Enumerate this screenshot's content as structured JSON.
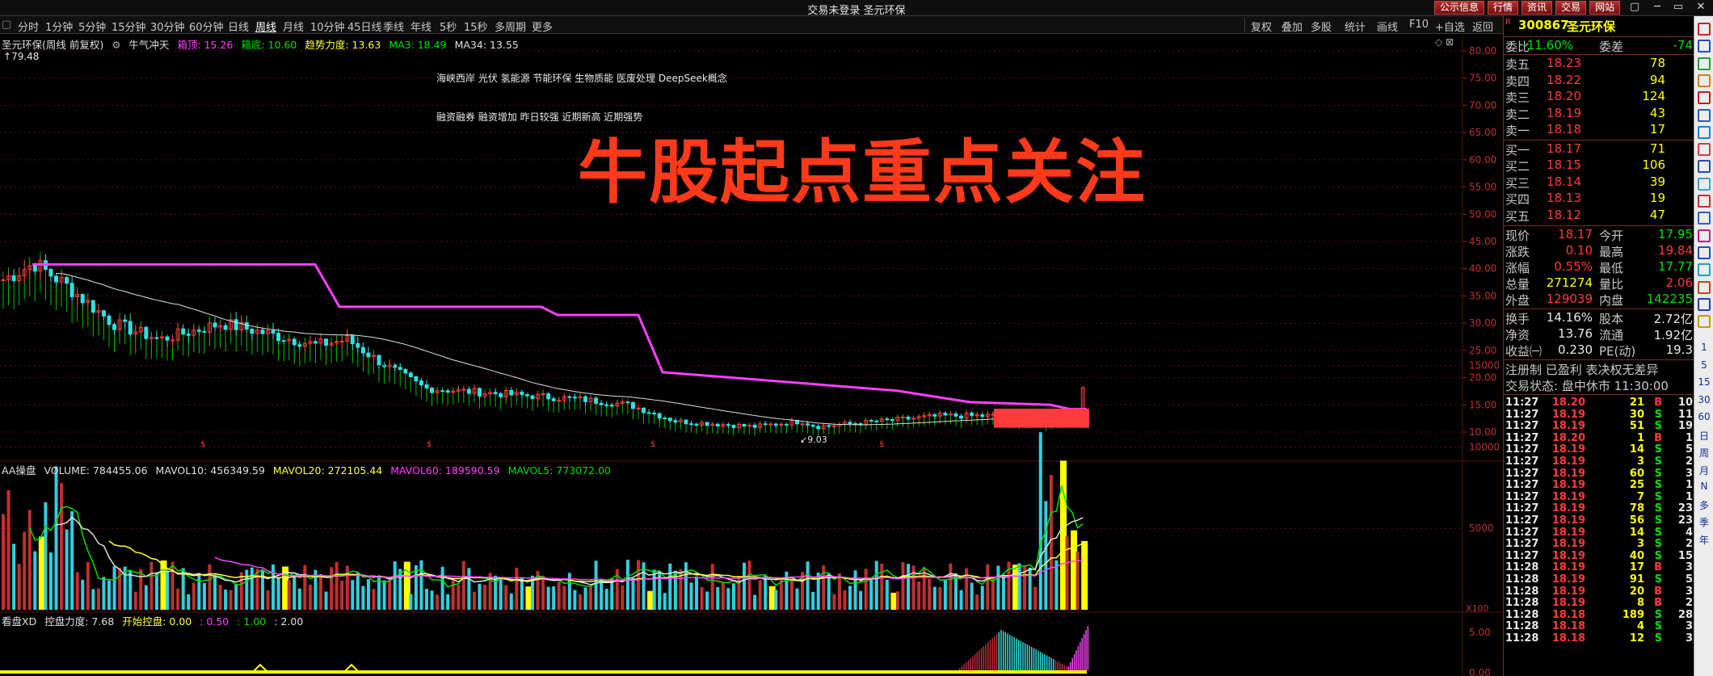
{
  "window": {
    "title": "交易未登录 圣元环保",
    "top_buttons": [
      "公示信息",
      "行情",
      "资讯",
      "交易",
      "网站"
    ],
    "controls": [
      "▢",
      "─",
      "▭",
      "✕"
    ]
  },
  "toolbar": {
    "periods": [
      "分时",
      "1分钟",
      "5分钟",
      "15分钟",
      "30分钟",
      "60分钟",
      "日线",
      "周线",
      "月线",
      "10分钟",
      "45日线",
      "季线",
      "年线",
      "5秒",
      "15秒",
      "多周期",
      "更多"
    ],
    "active_period": "周线",
    "tools": [
      "复权",
      "叠加",
      "多股",
      "统计",
      "画线",
      "F10",
      "+自选",
      "返回"
    ]
  },
  "chart_header": {
    "stock": "圣元环保(周线 前复权)",
    "indicator": "牛气冲天",
    "items": [
      {
        "label": "箱顶: 15.26",
        "color": "#ff40ff"
      },
      {
        "label": "箱底: 10.60",
        "color": "#00e000"
      },
      {
        "label": "趋势力度: 13.63",
        "color": "#ffff40"
      },
      {
        "label": "MA3: 18.49",
        "color": "#00e000"
      },
      {
        "label": "MA34: 13.55",
        "color": "#e0e0e0"
      }
    ],
    "high_mark": "79.48",
    "low_mark": "9.03"
  },
  "concepts": {
    "line1": "海峡西岸 光伏 氢能源 节能环保 生物质能 医废处理 DeepSeek概念",
    "line2": "融资融券 融资增加 昨日较强 近期新高 近期强势"
  },
  "overlay_text": "牛股起点重点关注",
  "price_axis": [
    "80.00",
    "75.00",
    "70.00",
    "65.00",
    "60.00",
    "55.00",
    "50.00",
    "45.00",
    "40.00",
    "35.00",
    "30.00",
    "25.00",
    "20.00",
    "15.00",
    "10.00"
  ],
  "volume_header": {
    "name": "AA操盘",
    "items": [
      {
        "label": "VOLUME: 784455.06",
        "color": "#e0e0e0"
      },
      {
        "label": "MAVOL10: 456349.59",
        "color": "#e0e0e0"
      },
      {
        "label": "MAVOL20: 272105.44",
        "color": "#ffff40"
      },
      {
        "label": "MAVOL60: 189590.59",
        "color": "#ff40ff"
      },
      {
        "label": "MAVOL5: 773072.00",
        "color": "#00e000"
      }
    ],
    "axis": [
      "15000",
      "10000",
      "5000"
    ],
    "unit": "X100"
  },
  "control_header": {
    "name": "看盘XD",
    "items": [
      {
        "label": "控盘力度: 7.68",
        "color": "#e0e0e0"
      },
      {
        "label": "开始控盘: 0.00",
        "color": "#ffff40"
      },
      {
        "label": ": 0.50",
        "color": "#ff40ff"
      },
      {
        "label": ": 1.00",
        "color": "#00e000"
      },
      {
        "label": ": 2.00",
        "color": "#e0e0e0"
      }
    ],
    "axis": [
      "5.00",
      "0.00"
    ]
  },
  "quote": {
    "code": "300867",
    "name": "圣元环保",
    "weibi_label": "委比",
    "weibi": "-11.60%",
    "weicha_label": "委差",
    "weicha": "-74",
    "asks": [
      {
        "label": "卖五",
        "price": "18.23",
        "vol": "78"
      },
      {
        "label": "卖四",
        "price": "18.22",
        "vol": "94"
      },
      {
        "label": "卖三",
        "price": "18.20",
        "vol": "124"
      },
      {
        "label": "卖二",
        "price": "18.19",
        "vol": "43"
      },
      {
        "label": "卖一",
        "price": "18.18",
        "vol": "17"
      }
    ],
    "bids": [
      {
        "label": "买一",
        "price": "18.17",
        "vol": "71"
      },
      {
        "label": "买二",
        "price": "18.15",
        "vol": "106"
      },
      {
        "label": "买三",
        "price": "18.14",
        "vol": "39"
      },
      {
        "label": "买四",
        "price": "18.13",
        "vol": "19"
      },
      {
        "label": "买五",
        "price": "18.12",
        "vol": "47"
      }
    ],
    "stats": [
      {
        "l1": "现价",
        "v1": "18.17",
        "c1": "red",
        "l2": "今开",
        "v2": "17.95",
        "c2": "green"
      },
      {
        "l1": "涨跌",
        "v1": "0.10",
        "c1": "red",
        "l2": "最高",
        "v2": "19.84",
        "c2": "red"
      },
      {
        "l1": "涨幅",
        "v1": "0.55%",
        "c1": "red",
        "l2": "最低",
        "v2": "17.77",
        "c2": "green"
      },
      {
        "l1": "总量",
        "v1": "271274",
        "c1": "yellow",
        "l2": "量比",
        "v2": "2.06",
        "c2": "red"
      },
      {
        "l1": "外盘",
        "v1": "129039",
        "c1": "red",
        "l2": "内盘",
        "v2": "142235",
        "c2": "green"
      }
    ],
    "fundamentals": [
      {
        "l1": "换手",
        "v1": "14.16%",
        "l2": "股本",
        "v2": "2.72亿"
      },
      {
        "l1": "净资",
        "v1": "13.76",
        "l2": "流通",
        "v2": "1.92亿"
      },
      {
        "l1": "收益㈠",
        "v1": "0.230",
        "l2": "PE(动)",
        "v2": "19.3"
      }
    ],
    "registration": "注册制 已盈利 表决权无差异",
    "trade_status": "交易状态: 盘中休市 11:30:00"
  },
  "ticks": [
    {
      "t": "11:27",
      "p": "18.20",
      "pc": "red",
      "v": "21",
      "d": "B",
      "n": "10"
    },
    {
      "t": "11:27",
      "p": "18.19",
      "pc": "red",
      "v": "30",
      "d": "S",
      "n": "11"
    },
    {
      "t": "11:27",
      "p": "18.19",
      "pc": "red",
      "v": "51",
      "d": "S",
      "n": "19"
    },
    {
      "t": "11:27",
      "p": "18.20",
      "pc": "red",
      "v": "1",
      "d": "B",
      "n": "1"
    },
    {
      "t": "11:27",
      "p": "18.19",
      "pc": "red",
      "v": "14",
      "d": "S",
      "n": "5"
    },
    {
      "t": "11:27",
      "p": "18.19",
      "pc": "red",
      "v": "3",
      "d": "S",
      "n": "2"
    },
    {
      "t": "11:27",
      "p": "18.19",
      "pc": "red",
      "v": "60",
      "d": "S",
      "n": "3"
    },
    {
      "t": "11:27",
      "p": "18.19",
      "pc": "red",
      "v": "25",
      "d": "S",
      "n": "1"
    },
    {
      "t": "11:27",
      "p": "18.19",
      "pc": "red",
      "v": "7",
      "d": "S",
      "n": "1"
    },
    {
      "t": "11:27",
      "p": "18.19",
      "pc": "red",
      "v": "78",
      "d": "S",
      "n": "23"
    },
    {
      "t": "11:27",
      "p": "18.19",
      "pc": "red",
      "v": "56",
      "d": "S",
      "n": "23"
    },
    {
      "t": "11:27",
      "p": "18.19",
      "pc": "red",
      "v": "14",
      "d": "S",
      "n": "4"
    },
    {
      "t": "11:27",
      "p": "18.19",
      "pc": "red",
      "v": "3",
      "d": "S",
      "n": "2"
    },
    {
      "t": "11:27",
      "p": "18.19",
      "pc": "red",
      "v": "40",
      "d": "S",
      "n": "15"
    },
    {
      "t": "11:28",
      "p": "18.19",
      "pc": "red",
      "v": "17",
      "d": "B",
      "n": "3"
    },
    {
      "t": "11:28",
      "p": "18.19",
      "pc": "red",
      "v": "91",
      "d": "S",
      "n": "5"
    },
    {
      "t": "11:28",
      "p": "18.19",
      "pc": "red",
      "v": "20",
      "d": "B",
      "n": "3"
    },
    {
      "t": "11:28",
      "p": "18.19",
      "pc": "red",
      "v": "8",
      "d": "B",
      "n": "2"
    },
    {
      "t": "11:28",
      "p": "18.18",
      "pc": "red",
      "v": "189",
      "d": "S",
      "n": "28"
    },
    {
      "t": "11:28",
      "p": "18.18",
      "pc": "red",
      "v": "4",
      "d": "S",
      "n": "3"
    },
    {
      "t": "11:28",
      "p": "18.18",
      "pc": "red",
      "v": "12",
      "d": "S",
      "n": "3"
    }
  ],
  "sidebar_labels": [
    "1",
    "5",
    "15",
    "30",
    "60",
    "日",
    "周",
    "月",
    "N",
    "多",
    "季",
    "年"
  ],
  "colors": {
    "up": "#ff3b3b",
    "down": "#00e000",
    "box_top": "#ff40ff",
    "ma34": "#e0e0e0",
    "volume_ma20": "#ffff40",
    "overlay": "#ff3a1a",
    "grid": "#5a1010"
  }
}
